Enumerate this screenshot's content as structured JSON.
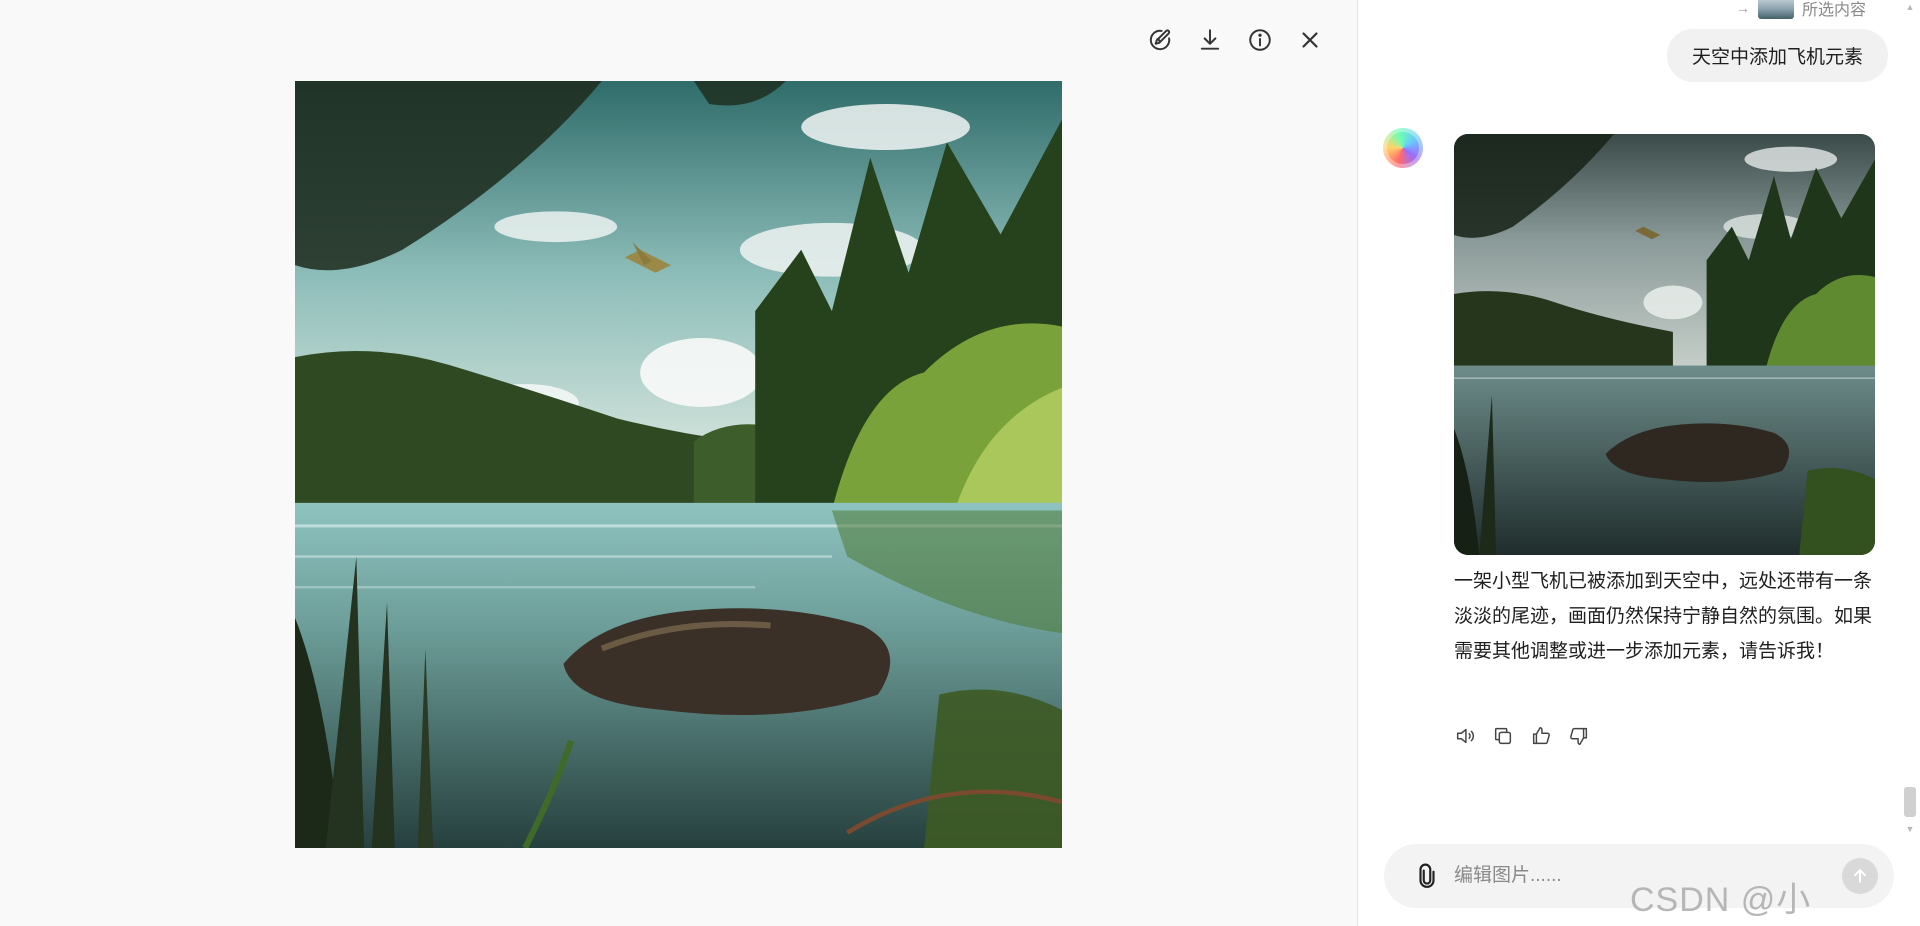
{
  "viewer": {
    "toolbar": [
      {
        "name": "edit-image-icon",
        "label": "编辑"
      },
      {
        "name": "download-icon",
        "label": "下载"
      },
      {
        "name": "info-icon",
        "label": "信息"
      },
      {
        "name": "close-icon",
        "label": "关闭"
      }
    ]
  },
  "chat": {
    "reference": {
      "label": "所选内容"
    },
    "user_message": "天空中添加飞机元素",
    "assistant_reply": "一架小型飞机已被添加到天空中，远处还带有一条淡淡的尾迹，画面仍然保持宁静自然的氛围。如果需要其他调整或进一步添加元素，请告诉我！",
    "actions": [
      "speaker-icon",
      "copy-icon",
      "thumbs-up-icon",
      "thumbs-down-icon"
    ],
    "composer": {
      "placeholder": "编辑图片......"
    }
  },
  "watermark": "CSDN @小",
  "colors": {
    "sky": "#9fc6c7",
    "foliage": "#3f6a2a",
    "water": "#5d8e8f",
    "rock": "#3a3027"
  }
}
